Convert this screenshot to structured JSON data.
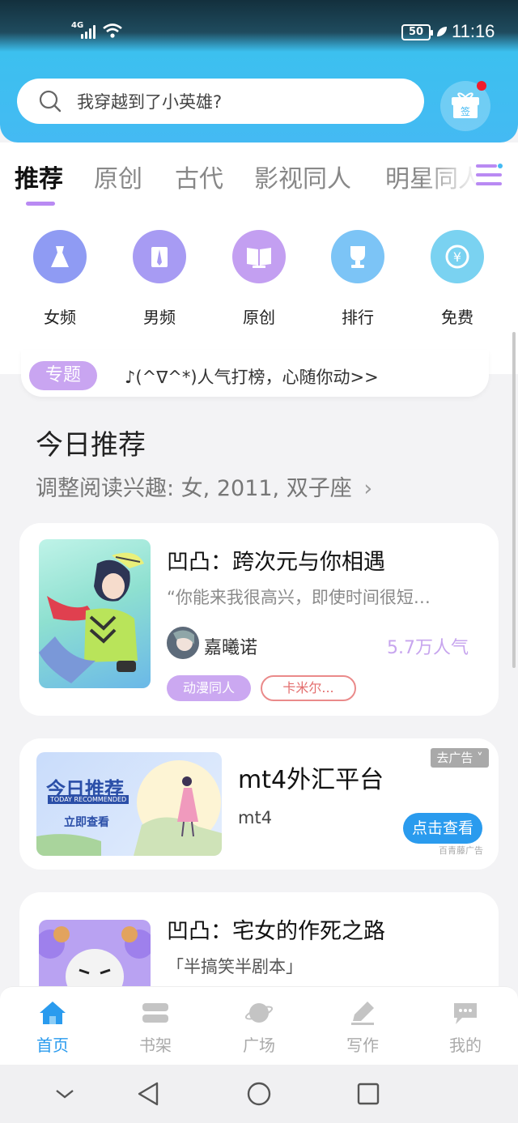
{
  "status_bar": {
    "network": "4G",
    "battery": "50",
    "time": "11:16"
  },
  "search": {
    "placeholder": "我穿越到了小英雄?"
  },
  "checkin": {
    "label": "签"
  },
  "tabs": [
    {
      "label": "推荐"
    },
    {
      "label": "原创"
    },
    {
      "label": "古代"
    },
    {
      "label": "影视同人"
    },
    {
      "label": "明星同人"
    }
  ],
  "categories": [
    {
      "label": "女频",
      "color": "#8f9bf3",
      "icon": "dress-icon"
    },
    {
      "label": "男频",
      "color": "#a79bf3",
      "icon": "shirt-icon"
    },
    {
      "label": "原创",
      "color": "#c39ff1",
      "icon": "book-icon"
    },
    {
      "label": "排行",
      "color": "#7cc4f6",
      "icon": "trophy-icon"
    },
    {
      "label": "免费",
      "color": "#7ad2f1",
      "icon": "yuan-coin-icon"
    }
  ],
  "topic": {
    "badge": "专题",
    "text": "♪(^∇^*)人气打榜，心随你动>>"
  },
  "recommend": {
    "title": "今日推荐",
    "subtitle": "调整阅读兴趣: 女, 2011, 双子座"
  },
  "books": [
    {
      "title": "凹凸：跨次元与你相遇",
      "desc": "“你能来我很高兴，即使时间很短…",
      "author": "嘉曦诺",
      "popularity": "5.7万人气",
      "tags": [
        "动漫同人",
        "卡米尔..."
      ]
    },
    {
      "title": "凹凸：宅女的作死之路",
      "desc": "「半搞笑半剧本」"
    }
  ],
  "ad": {
    "close_label": "去广告",
    "banner_title": "今日推荐",
    "banner_en": "TODAY RECOMMENDED",
    "banner_cta": "立即查看",
    "title": "mt4外汇平台",
    "desc": "mt4",
    "button": "点击查看",
    "source": "百青藤广告"
  },
  "bottom_nav": [
    {
      "label": "首页",
      "icon": "home-icon",
      "active": true
    },
    {
      "label": "书架",
      "icon": "bookshelf-icon"
    },
    {
      "label": "广场",
      "icon": "planet-icon"
    },
    {
      "label": "写作",
      "icon": "pen-icon"
    },
    {
      "label": "我的",
      "icon": "chat-bubble-icon"
    }
  ],
  "colors": {
    "accent": "#2a9bee",
    "purple": "#b98af3"
  }
}
